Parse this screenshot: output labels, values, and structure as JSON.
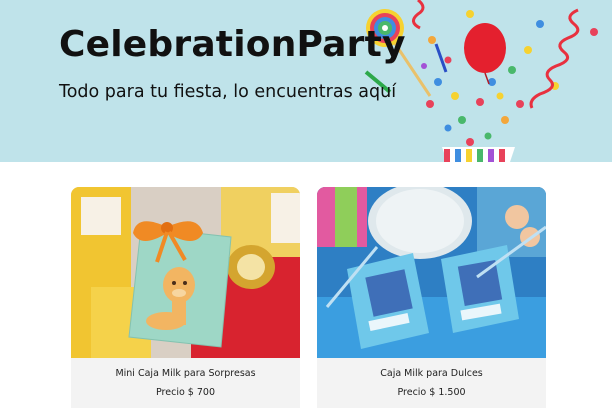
{
  "hero": {
    "title": "CelebrationParty",
    "subtitle": "Todo para tu fiesta, lo encuentras aquí"
  },
  "products": [
    {
      "name": "Mini Caja Milk para Sorpresas",
      "price": "Precio $ 700"
    },
    {
      "name": "Caja Milk para Dulces",
      "price": "Precio $ 1.500"
    }
  ],
  "colors": {
    "hero_background": "#bfe3ea",
    "card_background": "#f3f3f3",
    "text": "#111111"
  }
}
